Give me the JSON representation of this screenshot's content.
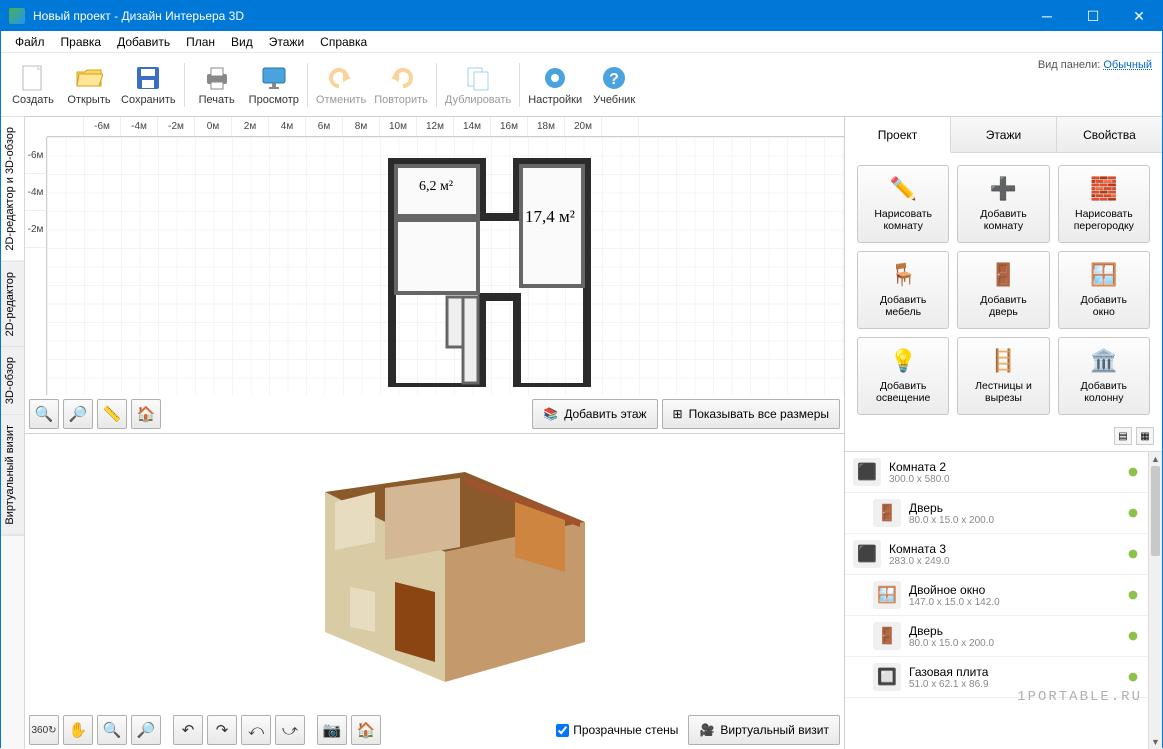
{
  "title": "Новый проект - Дизайн Интерьера 3D",
  "menu": [
    "Файл",
    "Правка",
    "Добавить",
    "План",
    "Вид",
    "Этажи",
    "Справка"
  ],
  "toolbar": {
    "create": "Создать",
    "open": "Открыть",
    "save": "Сохранить",
    "print": "Печать",
    "preview": "Просмотр",
    "undo": "Отменить",
    "redo": "Повторить",
    "duplicate": "Дублировать",
    "settings": "Настройки",
    "tutorial": "Учебник",
    "panelMode": "Вид панели:",
    "panelModeValue": "Обычный"
  },
  "vtabs": [
    "2D-редактор и 3D-обзор",
    "2D-редактор",
    "3D-обзор",
    "Виртуальный визит"
  ],
  "rulerH": [
    "",
    "-6м",
    "-4м",
    "-2м",
    "0м",
    "2м",
    "4м",
    "6м",
    "8м",
    "10м",
    "12м",
    "14м",
    "16м",
    "18м",
    "20м",
    ""
  ],
  "rulerV": [
    "-6м",
    "-4м",
    "-2м"
  ],
  "roomLabels": {
    "r1": "6,2 м²",
    "r2": "17,4 м²"
  },
  "actions2d": {
    "addFloor": "Добавить этаж",
    "showDims": "Показывать все размеры"
  },
  "actions3d": {
    "transparent": "Прозрачные стены",
    "virtual": "Виртуальный визит"
  },
  "rtabs": [
    "Проект",
    "Этажи",
    "Свойства"
  ],
  "tools": [
    {
      "l1": "Нарисовать",
      "l2": "комнату",
      "icon": "pencil"
    },
    {
      "l1": "Добавить",
      "l2": "комнату",
      "icon": "addroom"
    },
    {
      "l1": "Нарисовать",
      "l2": "перегородку",
      "icon": "wall"
    },
    {
      "l1": "Добавить",
      "l2": "мебель",
      "icon": "chair"
    },
    {
      "l1": "Добавить",
      "l2": "дверь",
      "icon": "door"
    },
    {
      "l1": "Добавить",
      "l2": "окно",
      "icon": "window"
    },
    {
      "l1": "Добавить",
      "l2": "освещение",
      "icon": "bulb"
    },
    {
      "l1": "Лестницы и",
      "l2": "вырезы",
      "icon": "stairs"
    },
    {
      "l1": "Добавить",
      "l2": "колонну",
      "icon": "column"
    }
  ],
  "objects": [
    {
      "name": "Комната 2",
      "dim": "300.0 x 580.0",
      "indent": false,
      "icon": "room"
    },
    {
      "name": "Дверь",
      "dim": "80.0 x 15.0 x 200.0",
      "indent": true,
      "icon": "door"
    },
    {
      "name": "Комната 3",
      "dim": "283.0 x 249.0",
      "indent": false,
      "icon": "room"
    },
    {
      "name": "Двойное окно",
      "dim": "147.0 x 15.0 x 142.0",
      "indent": true,
      "icon": "window"
    },
    {
      "name": "Дверь",
      "dim": "80.0 x 15.0 x 200.0",
      "indent": true,
      "icon": "door"
    },
    {
      "name": "Газовая плита",
      "dim": "51.0 x 62.1 x 86.9",
      "indent": true,
      "icon": "stove"
    }
  ],
  "watermark": "1PORTABLE.RU"
}
